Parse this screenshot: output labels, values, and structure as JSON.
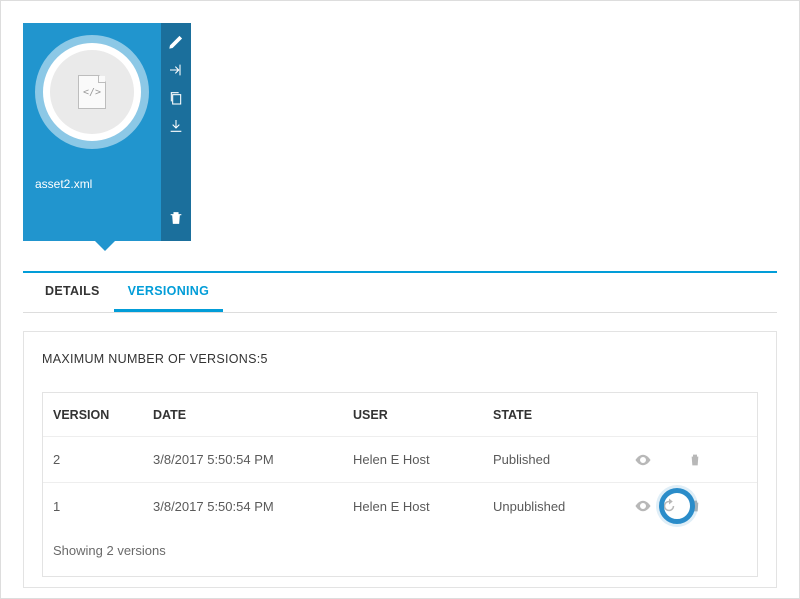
{
  "asset": {
    "filename": "asset2.xml",
    "file_glyph": "</>"
  },
  "tabs": {
    "details": "DETAILS",
    "versioning": "VERSIONING"
  },
  "panel": {
    "max_versions_label": "MAXIMUM NUMBER OF VERSIONS:",
    "max_versions_value": "5"
  },
  "table": {
    "headers": {
      "version": "VERSION",
      "date": "DATE",
      "user": "USER",
      "state": "STATE"
    },
    "rows": [
      {
        "version": "2",
        "date": "3/8/2017 5:50:54 PM",
        "user": "Helen E Host",
        "state": "Published",
        "restorable": false
      },
      {
        "version": "1",
        "date": "3/8/2017 5:50:54 PM",
        "user": "Helen E Host",
        "state": "Unpublished",
        "restorable": true
      }
    ],
    "footer": "Showing 2 versions"
  }
}
